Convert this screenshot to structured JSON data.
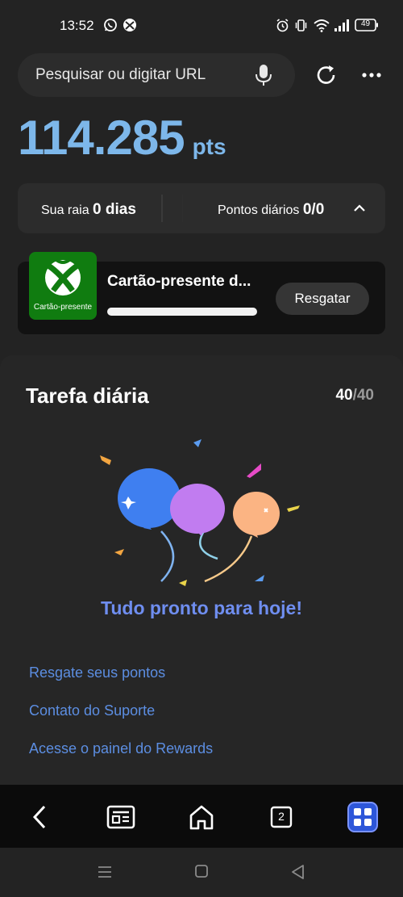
{
  "status": {
    "time": "13:52",
    "battery": "49"
  },
  "search": {
    "placeholder": "Pesquisar ou digitar URL"
  },
  "points": {
    "value": "114.285",
    "unit": "pts"
  },
  "streak": {
    "label": "Sua raia",
    "value": "0 dias"
  },
  "daily": {
    "label": "Pontos diários",
    "value": "0/0"
  },
  "gift": {
    "thumb_label": "Cartão-presente",
    "title": "Cartão-presente d...",
    "redeem_label": "Resgatar",
    "progress": 1.0
  },
  "task": {
    "title": "Tarefa diária",
    "done": "40",
    "total": "40",
    "separator": "/",
    "done_message": "Tudo pronto para hoje!"
  },
  "links": [
    "Resgate seus pontos",
    "Contato do Suporte",
    "Acesse o painel do Rewards"
  ],
  "bottom_nav": {
    "tabs_count": "2"
  },
  "colors": {
    "accent": "#7db7ea",
    "link": "#5c8ee2",
    "xbox_green": "#107c10"
  }
}
